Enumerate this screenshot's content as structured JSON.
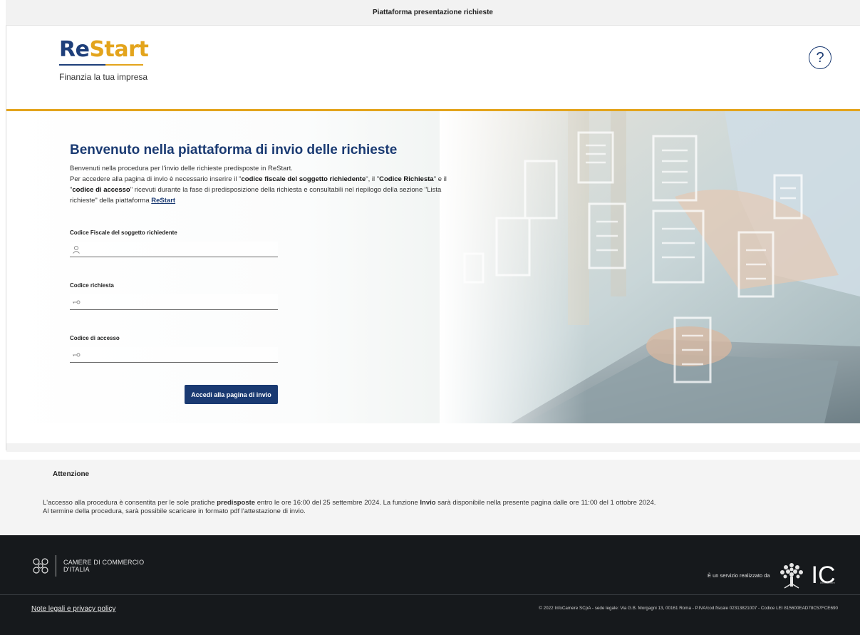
{
  "topbar": {
    "title": "Piattaforma presentazione richieste"
  },
  "brand": {
    "logo_re": "Re",
    "logo_start": "Start",
    "tagline": "Finanzia la tua impresa"
  },
  "help": {
    "icon": "help-circle-icon",
    "label": "?"
  },
  "hero": {
    "title": "Benvenuto nella piattaforma di invio delle richieste",
    "intro_line1": "Benvenuti nella procedura per l'invio delle richieste predisposte in ReStart.",
    "intro_p2_a": "Per accedere alla pagina di invio è necessario inserire il \"",
    "intro_p2_b1": "codice fiscale del soggetto richiedente",
    "intro_p2_c": "\", il \"",
    "intro_p2_b2": "Codice Richiesta",
    "intro_p2_d": "\" e il \"",
    "intro_p2_b3": "codice di accesso",
    "intro_p2_e": "\" ricevuti durante la fase di predisposizione della richiesta e consultabili nel riepilogo della sezione \"Lista richieste\" della piattaforma ",
    "intro_link": "ReStart"
  },
  "form": {
    "fields": [
      {
        "label": "Codice Fiscale del soggetto richiedente",
        "value": "",
        "icon": "user-icon"
      },
      {
        "label": "Codice richiesta",
        "value": "",
        "icon": "key-icon"
      },
      {
        "label": "Codice di accesso",
        "value": "",
        "icon": "key-icon"
      }
    ],
    "submit_label": "Accedi alla pagina di invio"
  },
  "notice": {
    "title": "Attenzione",
    "l1_a": "L'accesso alla procedura è consentita per le sole pratiche ",
    "l1_b": "predisposte",
    "l1_c": " entro le ore 16:00 del 25 settembre 2024. La funzione ",
    "l1_d": "Invio",
    "l1_e": " sarà disponibile nella presente pagina dalle ore 11:00 del 1 ottobre 2024.",
    "l2": "Al termine della procedura, sarà possibile scaricare in formato pdf l'attestazione di invio."
  },
  "footer": {
    "ccia_line1": "CAMERE DI COMMERCIO",
    "ccia_line2": "D'ITALIA",
    "service_text": "È un servizio realizzato da",
    "ic_logo": "IC",
    "ic_small": "InfoCamere",
    "legal_link": "Note legali e privacy policy",
    "copyright": "© 2022 InfoCamere SCpA - sede legale: Via G.B. Morgagni 13, 00161 Roma - P.IVA/cod.fiscale 02313821007 - Codice LEI 815600EAD78C57FCE690"
  },
  "colors": {
    "primary": "#1a3a72",
    "accent": "#e3a41c",
    "footer_bg": "#16191c"
  }
}
